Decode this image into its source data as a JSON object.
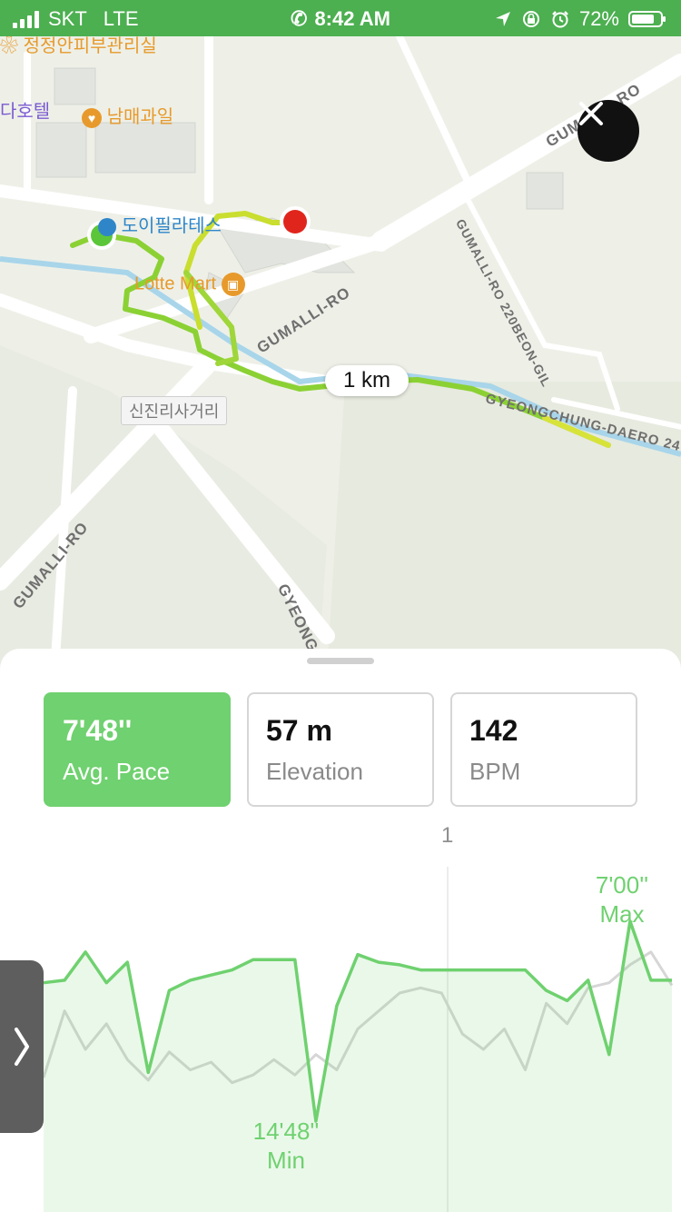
{
  "status_bar": {
    "carrier": "SKT",
    "network": "LTE",
    "time": "8:42 AM",
    "battery": "72%",
    "battery_level": 0.72,
    "icons": [
      "signal-icon",
      "phone-icon",
      "location-icon",
      "orientation-lock-icon",
      "alarm-icon",
      "battery-icon"
    ]
  },
  "map": {
    "pois": [
      {
        "name": "정정안피부관리실",
        "color": "#e79a2b",
        "icon": "poi-lotus-icon"
      },
      {
        "name": "다호텔",
        "color": "#7a5ad1"
      },
      {
        "name": "남매과일",
        "color": "#e79a2b",
        "icon": "poi-basket-icon"
      },
      {
        "name": "도이필라테스",
        "color": "#2e86c9",
        "icon": "poi-dot-icon"
      },
      {
        "name": "Lotte Mart",
        "color": "#e79a2b",
        "icon": "poi-shopping-bag-icon"
      }
    ],
    "road_labels": {
      "gumalli_top": "GUMALLI-RO",
      "gumalli_220": "GUMALLI-RO 220BEON-GIL",
      "gumalli_mid": "GUMALLI-RO",
      "gyeongchung": "GYEONGCHUNG-DAERO 24",
      "gumalli_bottom": "GUMALLI-RO",
      "gyeong_bottom": "GYEONG"
    },
    "place_label": "신진리사거리",
    "distance_marker": "1 km",
    "start_marker_color": "#5cc63a",
    "end_marker_color": "#e0261c"
  },
  "stats": [
    {
      "value": "7'48''",
      "label": "Avg. Pace"
    },
    {
      "value": "57 m",
      "label": "Elevation"
    },
    {
      "value": "142",
      "label": "BPM"
    }
  ],
  "chart_data": {
    "type": "line",
    "x_tick_label": "1",
    "series": [
      {
        "color": "#6fd16f",
        "values": [
          9.4,
          9.3,
          8.2,
          9.4,
          8.6,
          12.9,
          9.7,
          9.3,
          9.1,
          8.9,
          8.5,
          8.5,
          8.5,
          14.8,
          10.3,
          8.3,
          8.6,
          8.7,
          8.9,
          8.9,
          8.9,
          8.9,
          8.9,
          8.9,
          9.7,
          10.1,
          9.3,
          12.2,
          7.0,
          9.3,
          9.3
        ]
      },
      {
        "color": "#d6d6d6",
        "values": [
          13.1,
          10.5,
          12.0,
          11.0,
          12.4,
          13.2,
          12.1,
          12.8,
          12.5,
          13.3,
          13.0,
          12.4,
          13.0,
          12.2,
          12.8,
          11.2,
          10.5,
          9.8,
          9.6,
          9.8,
          11.4,
          12.0,
          11.2,
          12.8,
          10.2,
          11.0,
          9.6,
          9.4,
          8.7,
          8.2,
          9.5
        ]
      }
    ],
    "annotations": [
      {
        "value": "7'00''",
        "label": "Max"
      },
      {
        "value": "14'48''",
        "label": "Min"
      }
    ]
  },
  "side_tab": {
    "icon": "chevron-right-icon"
  },
  "close_button": {
    "icon": "close-icon"
  }
}
